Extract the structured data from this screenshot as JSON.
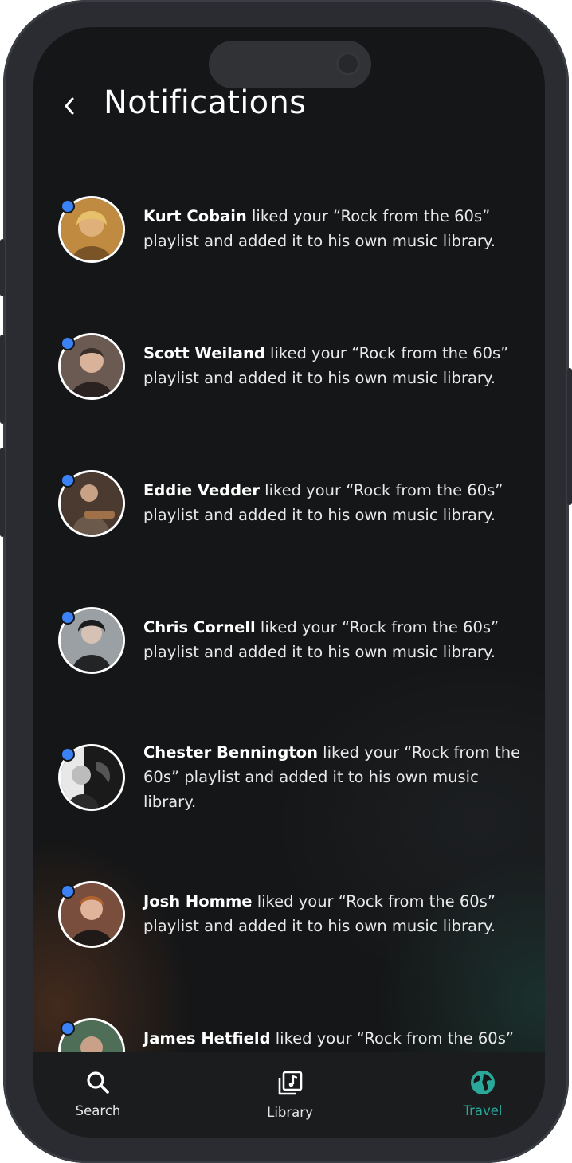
{
  "header": {
    "title": "Notifications"
  },
  "notifications": [
    {
      "name": "Kurt Cobain",
      "rest": "liked your “Rock from the 60s” playlist and added it to his own music library.",
      "avatar_color": "#c08a40"
    },
    {
      "name": "Scott Weiland",
      "rest": "liked your “Rock from the 60s” playlist and added it to his own music library.",
      "avatar_color": "#6a5a52"
    },
    {
      "name": "Eddie Vedder",
      "rest": "liked your “Rock from the 60s” playlist and added it to his own music library.",
      "avatar_color": "#4a3a30"
    },
    {
      "name": "Chris Cornell",
      "rest": "liked your “Rock from the 60s” playlist and added it to his own music library.",
      "avatar_color": "#9aa0a4"
    },
    {
      "name": "Chester Bennington",
      "rest": "liked your “Rock from the 60s” playlist and added it to his own music library.",
      "avatar_color": "#2a2a2a"
    },
    {
      "name": "Josh Homme",
      "rest": "liked your “Rock from the 60s” playlist and added it to his own music library.",
      "avatar_color": "#7a4e3c"
    },
    {
      "name": "James Hetfield",
      "rest": "liked your “Rock from the 60s”",
      "avatar_color": "#4f6e58"
    }
  ],
  "tabs": [
    {
      "label": "Search",
      "icon": "search-icon"
    },
    {
      "label": "Library",
      "icon": "library-icon"
    },
    {
      "label": "Travel",
      "icon": "globe-icon",
      "active": true
    }
  ],
  "colors": {
    "unread_dot": "#3b82f6",
    "active_tab": "#2aa89a",
    "background": "#151617"
  }
}
